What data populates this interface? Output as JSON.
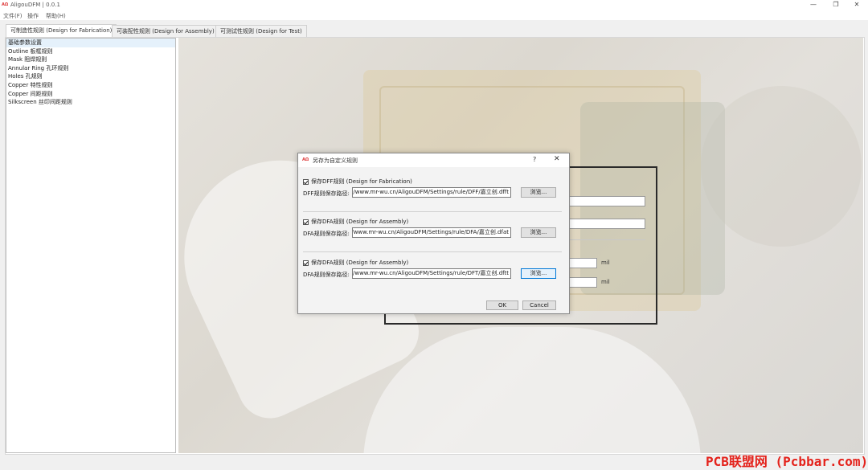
{
  "window": {
    "title": "AligouDFM | 0.0.1",
    "app_icon": "ΑΩ",
    "minimize": "—",
    "maximize": "❐",
    "close": "✕"
  },
  "menu": [
    "文件(F)",
    "操作",
    "帮助(H)"
  ],
  "tabs": [
    "可制造性规则 (Design for Fabrication)",
    "可装配性规则 (Design for Assembly)",
    "可测试性规则 (Design for Test)"
  ],
  "sidebar": {
    "items": [
      "基础参数设置",
      "Outline 板框规则",
      "Mask 阻焊规则",
      "Annular Ring 孔环规则",
      "Holes 孔规则",
      "Copper 特性规则",
      "Copper 间距规则",
      "Silkscreen 丝印间距规则"
    ],
    "selected_index": 0
  },
  "background_form": {
    "unit_1": "mil",
    "unit_2": "mil"
  },
  "dialog": {
    "title": "另存为自定义规则",
    "help": "?",
    "close": "✕",
    "sections": [
      {
        "checkbox_label": "保存DFF规则 (Design for Fabrication)",
        "checked": true,
        "path_label": "DFF规则保存路径:",
        "path_value": "C:/Users/Administrator/AppData/Roaming/www.mr-wu.cn/AligouDFM/Settings/rule/DFF/嘉立创.dfft",
        "browse_label": "浏览..."
      },
      {
        "checkbox_label": "保存DFA规则 (Design for Assembly)",
        "checked": true,
        "path_label": "DFA规则保存路径:",
        "path_value": "C:/Users/Administrator/AppData/Roaming/www.mr-wu.cn/AligouDFM/Settings/rule/DFA/嘉立创.dfat",
        "browse_label": "浏览..."
      },
      {
        "checkbox_label": "保存DFA规则 (Design for Assembly)",
        "checked": true,
        "path_label": "DFA规则保存路径:",
        "path_value": "C:/Users/Administrator/AppData/Roaming/www.mr-wu.cn/AligouDFM/Settings/rule/DFT/嘉立创.dftt",
        "browse_label": "浏览..."
      }
    ],
    "ok_label": "OK",
    "cancel_label": "Cancel"
  },
  "watermark": "PCB联盟网 (Pcbbar.com)",
  "colors": {
    "accent": "#0078d7",
    "watermark": "#e4221b",
    "selection": "#e5f1fb"
  }
}
